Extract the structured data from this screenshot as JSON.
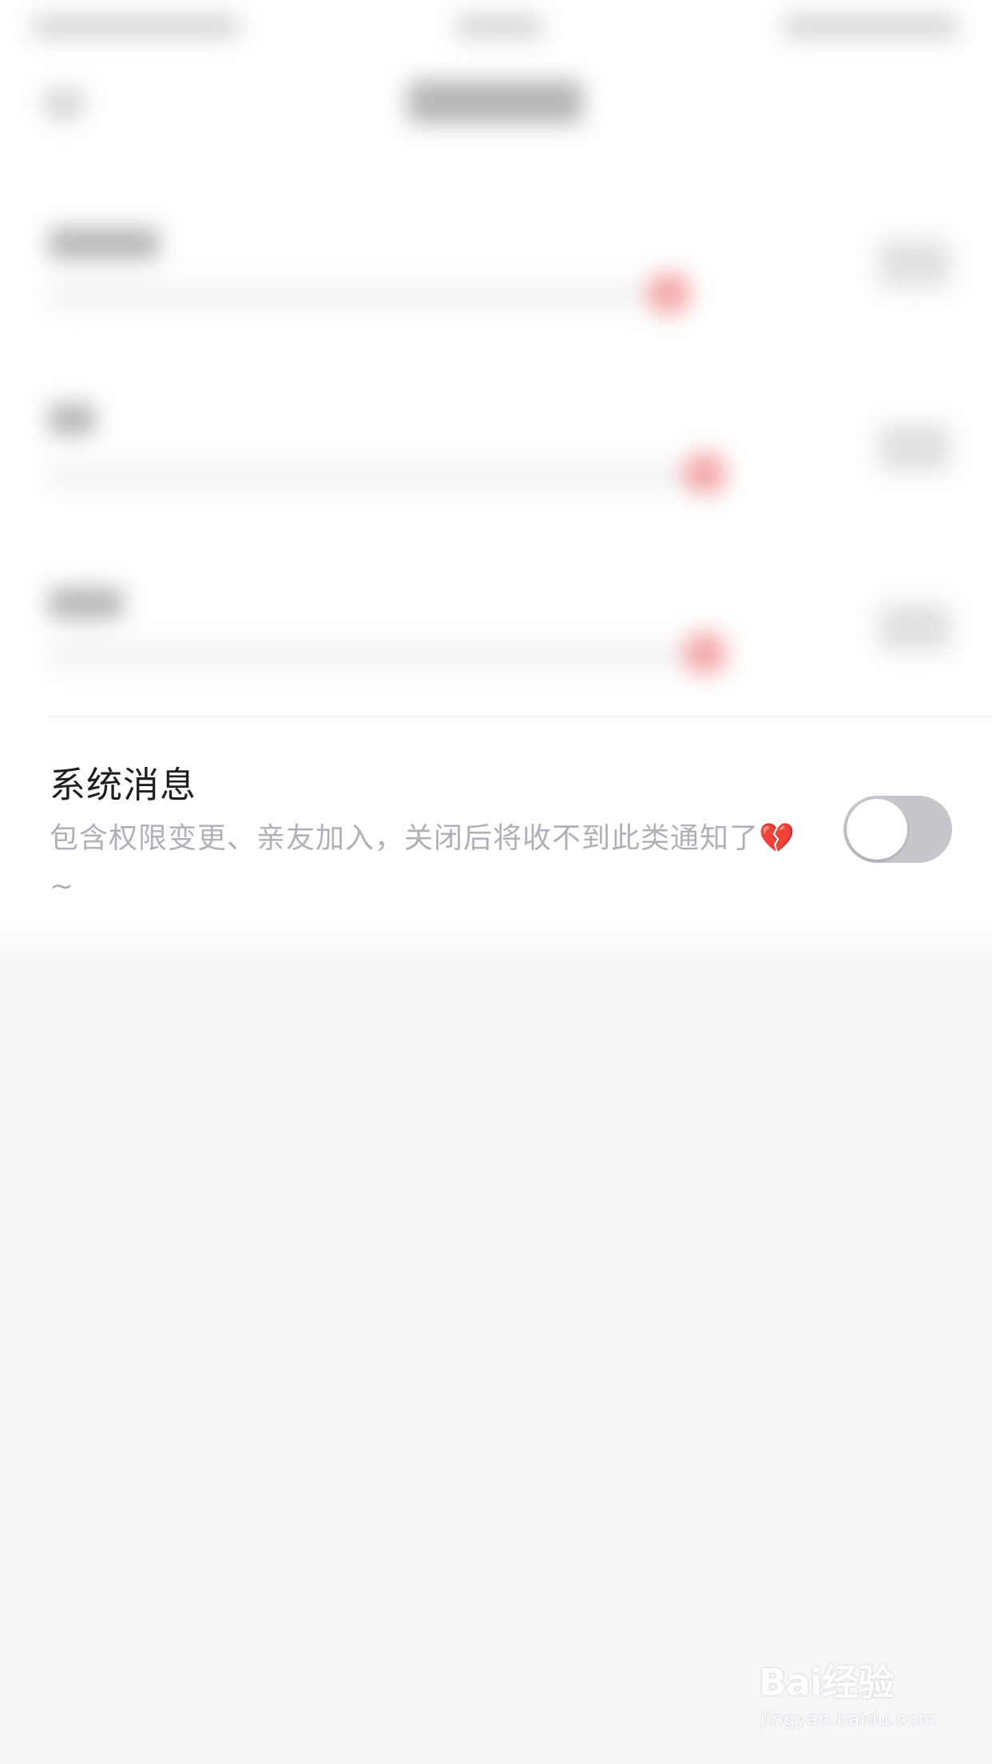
{
  "system_message": {
    "title": "系统消息",
    "description": "包含权限变更、亲友加入，关闭后将收不到此类通知了💔~",
    "toggle_on": false
  },
  "colors": {
    "background": "#f6f7f9",
    "card": "#ffffff",
    "toggle_off": "#c6c6cc",
    "description_text": "#b0b0b8"
  },
  "watermark": {
    "main": "Bai经验",
    "sub": "jingyan.baidu.com"
  }
}
